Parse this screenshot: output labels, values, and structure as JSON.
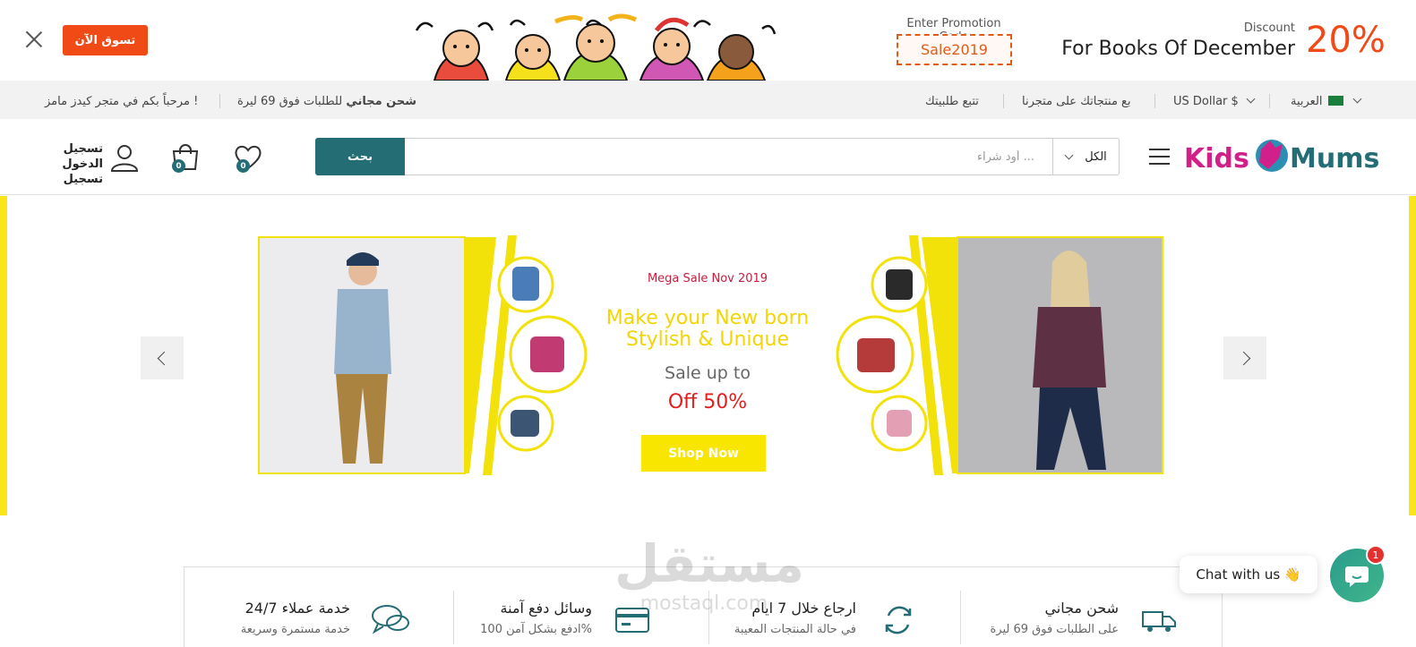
{
  "promo": {
    "shop_now_label": "تسوق الآن",
    "promo_code_label": "Enter Promotion Code",
    "promo_code": "Sale2019",
    "discount_label": "Discount",
    "discount_text": "For Books Of December",
    "discount_value": "20%"
  },
  "info_bar": {
    "welcome": "مرحباً بكم في متجر كيدز مامز !",
    "free_shipping_bold": "شحن مجاني",
    "free_shipping_rest": " للطلبات فوق 69 ليرة",
    "track_order": "تتبع طلبيتك",
    "sell_products": "بع منتجاتك على متجرنا",
    "currency": "US Dollar $",
    "language": "العربية"
  },
  "header": {
    "logo_left": "Kids",
    "logo_right": "Mums",
    "search_placeholder": "أود شراء ...",
    "search_button": "بحث",
    "category_selected": "الكل",
    "wishlist_count": "0",
    "cart_count": "0",
    "login_line1": "تسجيل الدخول",
    "login_line2": "تسجيل"
  },
  "hero": {
    "tag": "Mega Sale Nov 2019",
    "headline_1": "Make your New born",
    "headline_2": "Stylish & Unique",
    "sale_up_to": "Sale up to",
    "off": "Off 50%",
    "shop_button": "Shop Now"
  },
  "features": [
    {
      "title": "شحن مجاني",
      "subtitle": "على الطلبات فوق 69 ليرة"
    },
    {
      "title": "ارجاع خلال 7 ايام",
      "subtitle": "في حالة المنتجات المعيبة"
    },
    {
      "title": "وسائل دفع آمنة",
      "subtitle": "ادفع بشكل آمن 100%"
    },
    {
      "title": "24/7 خدمة عملاء",
      "subtitle": "خدمة مستمرة وسريعة"
    }
  ],
  "watermark": {
    "arabic": "مستقل",
    "latin": "mostaql.com"
  },
  "chat": {
    "label": "Chat with us 👋",
    "badge": "1"
  },
  "colors": {
    "accent": "#f04a17",
    "teal": "#256d75",
    "yellow": "#f9e600",
    "logo_pink": "#d2208a"
  }
}
